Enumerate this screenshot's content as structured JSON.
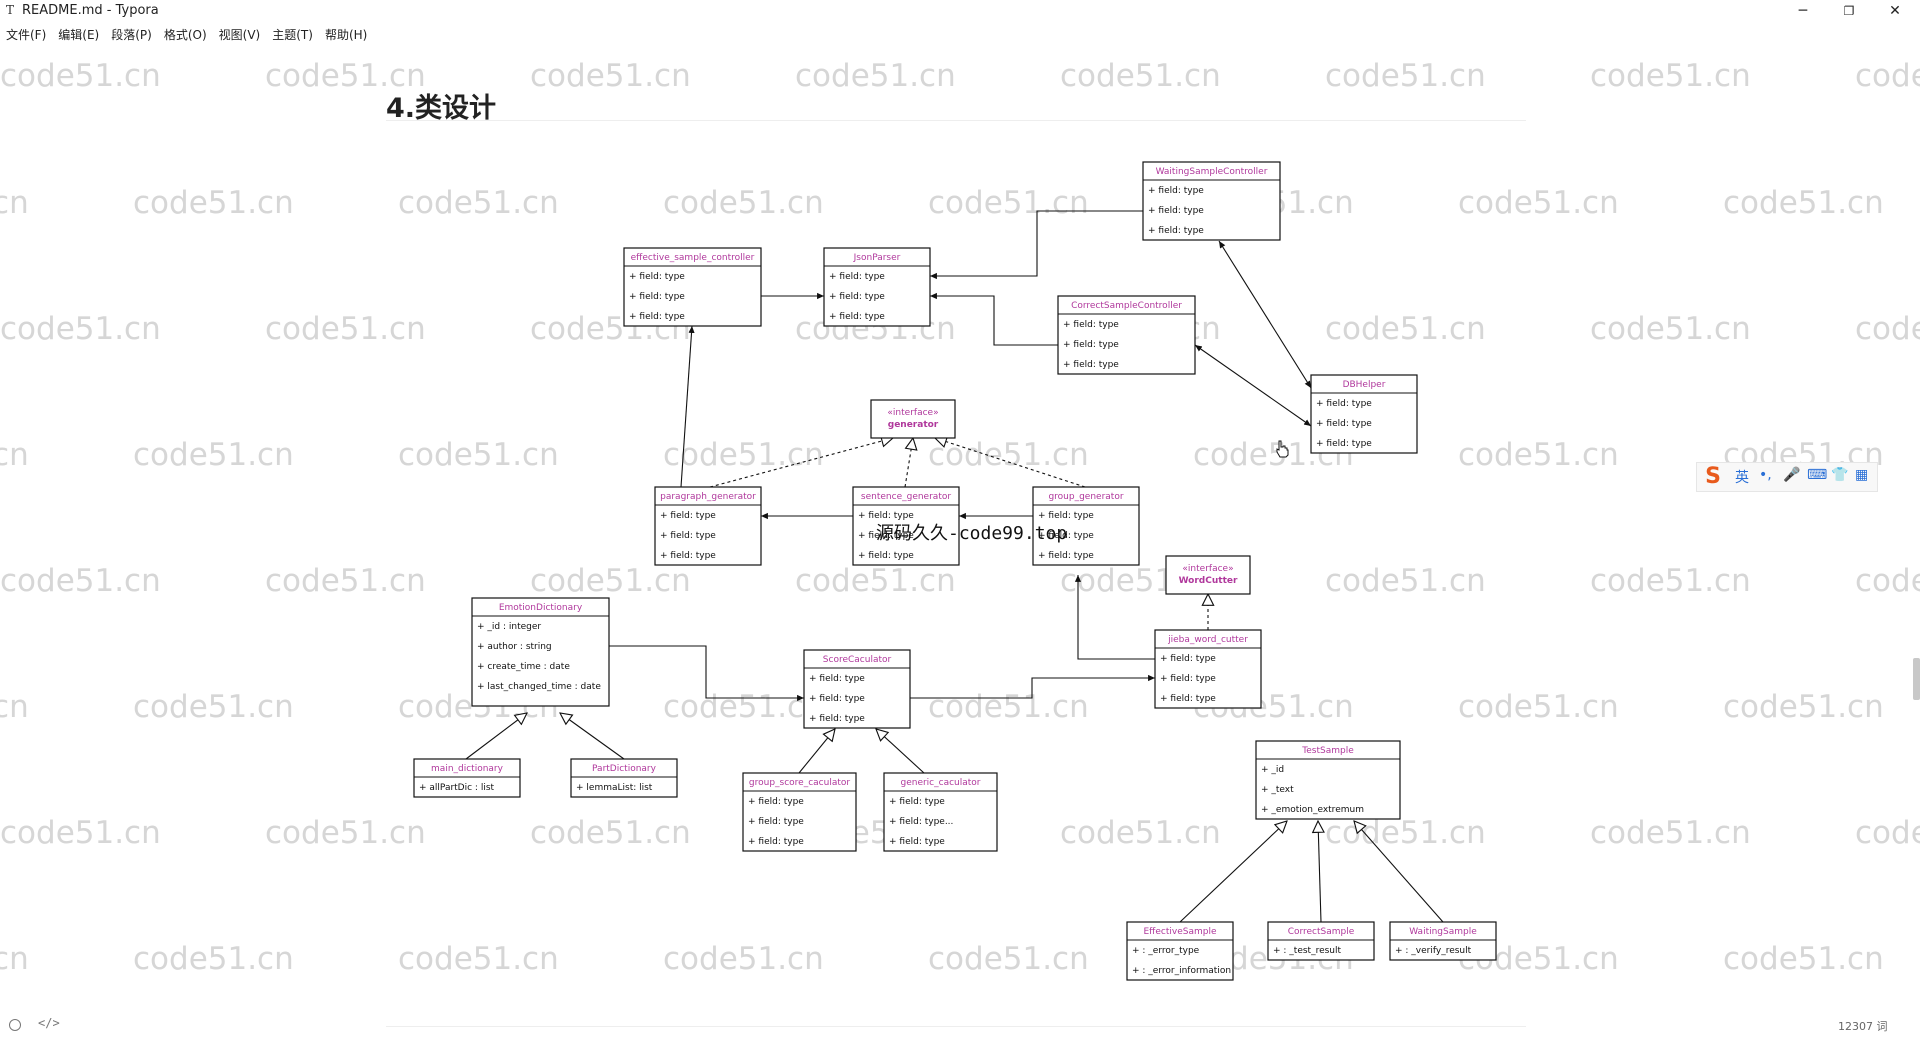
{
  "window": {
    "title": "README.md - Typora",
    "icon": "T",
    "controls": {
      "minimize": "─",
      "maximize": "❐",
      "close": "✕"
    }
  },
  "menu": [
    "文件(F)",
    "编辑(E)",
    "段落(P)",
    "格式(O)",
    "视图(V)",
    "主题(T)",
    "帮助(H)"
  ],
  "watermark": "code51.cn",
  "heading": "4.类设计",
  "overlay_text": "源码久久-code99.top",
  "ime": {
    "logo": "S",
    "buttons": [
      "英",
      "•,",
      "🎤",
      "⌨",
      "👕",
      "▦"
    ]
  },
  "status": {
    "source_toggle": "</>",
    "word_count": "12307 词"
  },
  "diagram": {
    "classes": [
      {
        "id": "waiting_ctrl",
        "title": "WaitingSampleController",
        "fields": [
          "+ field: type",
          "+ field: type",
          "+ field: type"
        ]
      },
      {
        "id": "effective_ctrl",
        "title": "effective_sample_controller",
        "fields": [
          "+ field: type",
          "+ field: type",
          "+ field: type"
        ]
      },
      {
        "id": "json_parser",
        "title": "JsonParser",
        "fields": [
          "+ field: type",
          "+ field: type",
          "+ field: type"
        ]
      },
      {
        "id": "correct_ctrl",
        "title": "CorrectSampleController",
        "fields": [
          "+ field: type",
          "+ field: type",
          "+ field: type"
        ]
      },
      {
        "id": "db_helper",
        "title": "DBHelper",
        "fields": [
          "+ field: type",
          "+ field: type",
          "+ field: type"
        ]
      },
      {
        "id": "paragraph_gen",
        "title": "paragraph_generator",
        "fields": [
          "+ field: type",
          "+ field: type",
          "+ field: type"
        ]
      },
      {
        "id": "sentence_gen",
        "title": "sentence_generator",
        "fields": [
          "+ field: type",
          "+ field: type",
          "+ field: type"
        ]
      },
      {
        "id": "group_gen",
        "title": "group_generator",
        "fields": [
          "+ field: type",
          "+ field: type",
          "+ field: type"
        ]
      },
      {
        "id": "emotion_dict",
        "title": "EmotionDictionary",
        "fields": [
          "+ _id : integer",
          "+ author : string",
          "+ create_time : date",
          "+ last_changed_time : date"
        ]
      },
      {
        "id": "score_calc",
        "title": "ScoreCaculator",
        "fields": [
          "+ field: type",
          "+ field: type",
          "+ field: type"
        ]
      },
      {
        "id": "jieba",
        "title": "jieba_word_cutter",
        "fields": [
          "+ field: type",
          "+ field: type",
          "+ field: type"
        ]
      },
      {
        "id": "main_dict",
        "title": "main_dictionary",
        "fields": [
          "+ allPartDic : list"
        ]
      },
      {
        "id": "part_dict",
        "title": "PartDictionary",
        "fields": [
          "+ lemmaList: list"
        ]
      },
      {
        "id": "group_score",
        "title": "group_score_caculator",
        "fields": [
          "+ field: type",
          "+ field: type",
          "+ field: type"
        ]
      },
      {
        "id": "generic_calc",
        "title": "generic_caculator",
        "fields": [
          "+ field: type",
          "+ field: type...",
          "+ field: type"
        ]
      },
      {
        "id": "test_sample",
        "title": "TestSample",
        "fields": [
          "+ _id",
          "+ _text",
          "+ _emotion_extremum"
        ]
      },
      {
        "id": "effective_sample",
        "title": "EffectiveSample",
        "fields": [
          "+ : _error_type",
          "+ : _error_information"
        ]
      },
      {
        "id": "correct_sample",
        "title": "CorrectSample",
        "fields": [
          "+ : _test_result"
        ]
      },
      {
        "id": "waiting_sample",
        "title": "WaitingSample",
        "fields": [
          "+ : _verify_result"
        ]
      }
    ],
    "interfaces": [
      {
        "id": "generator",
        "stereotype": "«interface»",
        "name": "generator"
      },
      {
        "id": "word_cutter",
        "stereotype": "«interface»",
        "name": "WordCutter"
      }
    ]
  },
  "colors": {
    "class_title": "#b0389c",
    "watermark": "#d6d6d6",
    "ime_logo": "#e85a1c"
  }
}
